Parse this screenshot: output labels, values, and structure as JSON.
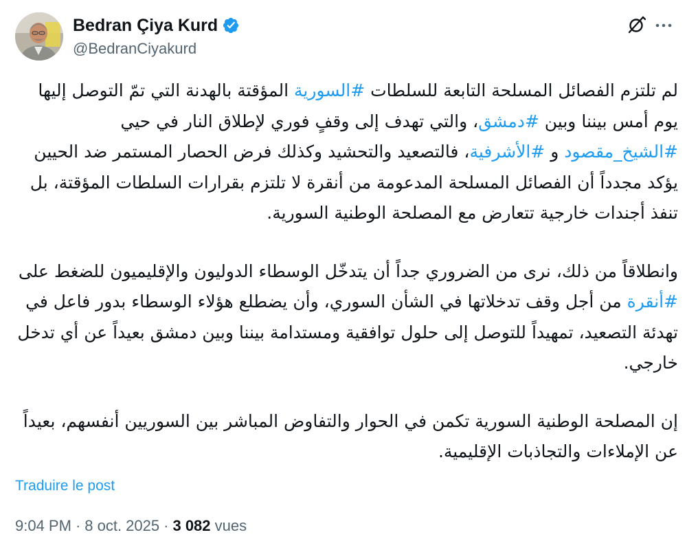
{
  "author": {
    "display_name": "Bedran Çiya Kurd",
    "handle": "@BedranCiyakurd",
    "verified": true,
    "avatar_icon": "profile-photo"
  },
  "actions": {
    "grok_icon": "grok-slash-circle-icon",
    "more_icon": "more-horizontal-icon"
  },
  "tweet": {
    "paragraph1": {
      "t1": "لم تلتزم الفصائل المسلحة التابعة للسلطات ",
      "h1": "#السورية",
      "t2": " المؤقتة بالهدنة التي تمّ التوصل إليها يوم أمس بيننا وبين ",
      "h2": "#دمشق",
      "t3": "، والتي تهدف إلى وقفٍ فوري لإطلاق النار في حيي ",
      "h3": "#الشيخ_مقصود",
      "t4": " و ",
      "h4": "#الأشرفية",
      "t5": "، فالتصعيد والتحشيد وكذلك فرض الحصار المستمر ضد الحيين يؤكد مجدداً أن الفصائل المسلحة المدعومة من أنقرة لا تلتزم بقرارات السلطات المؤقتة، بل تنفذ أجندات خارجية تتعارض مع المصلحة الوطنية السورية."
    },
    "paragraph2": {
      "t1": "وانطلاقاً من ذلك، نرى من الضروري جداً أن يتدخّل الوسطاء الدوليون والإقليميون للضغط على ",
      "h1": "#أنقرة",
      "t2": " من أجل وقف تدخلاتها في الشأن السوري، وأن يضطلع هؤلاء الوسطاء بدور فاعل في تهدئة التصعيد، تمهيداً للتوصل إلى حلول توافقية ومستدامة بيننا وبين دمشق بعيداً عن أي تدخل خارجي."
    },
    "paragraph3": {
      "t1": "إن المصلحة الوطنية السورية تكمن في الحوار والتفاوض المباشر بين السوريين أنفسهم، بعيداً عن الإملاءات والتجاذبات الإقليمية."
    }
  },
  "translate_label": "Traduire le post",
  "meta": {
    "time": "9:04 PM",
    "separator": "·",
    "date": "8 oct. 2025",
    "views_count": "3 082",
    "views_label": "vues"
  },
  "colors": {
    "link": "#1d9bf0",
    "text": "#0f1419",
    "secondary": "#536471",
    "verified_badge": "#1d9bf0"
  }
}
